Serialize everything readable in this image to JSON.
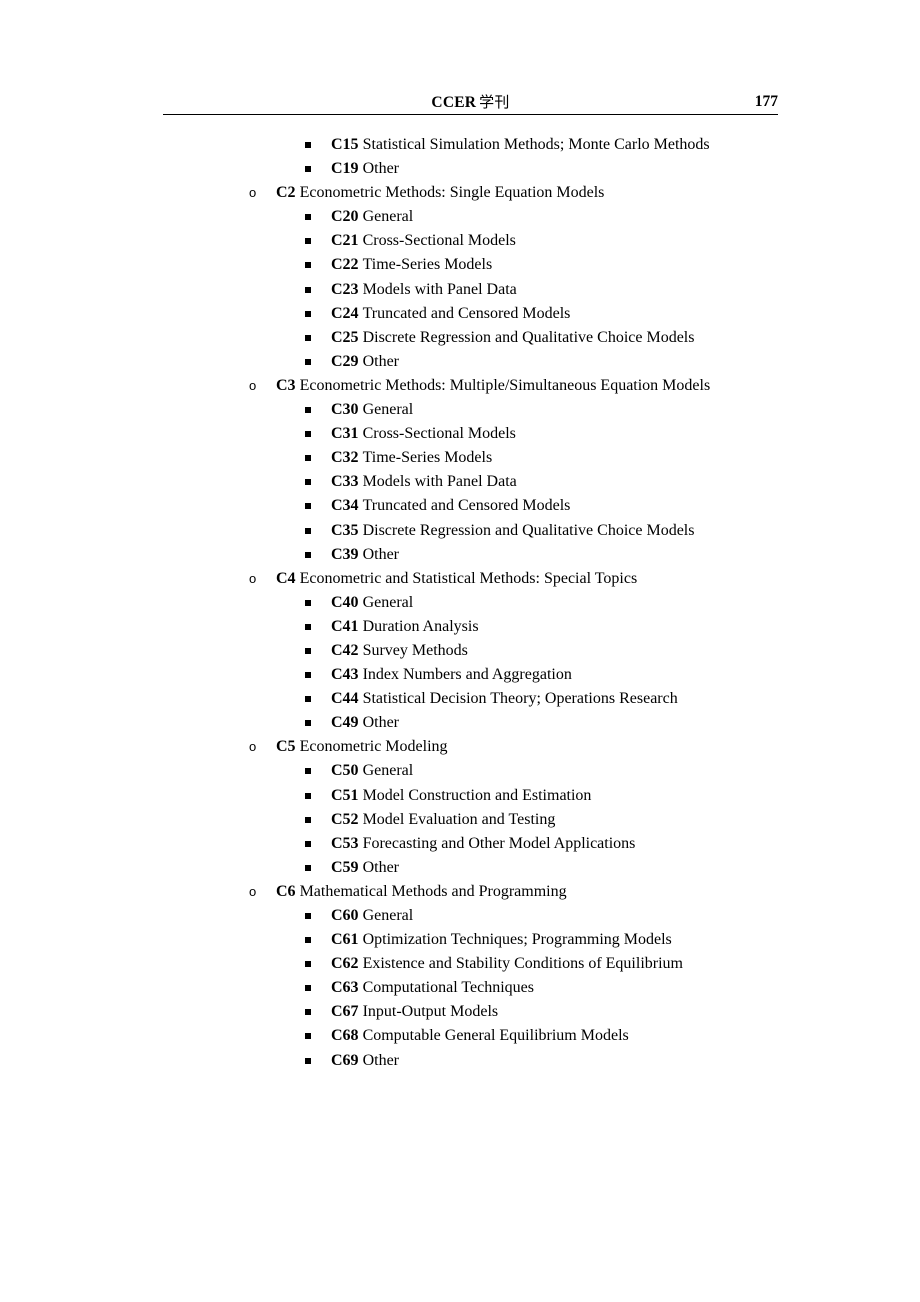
{
  "header": {
    "journal_latin": "CCER",
    "journal_cjk": "学刊",
    "page_number": "177"
  },
  "outline": {
    "rows": [
      {
        "level": 3,
        "bullet": "square-bullet",
        "code": "C15",
        "desc": "Statistical Simulation Methods; Monte Carlo Methods"
      },
      {
        "level": 3,
        "bullet": "square-bullet",
        "code": "C19",
        "desc": "Other"
      },
      {
        "level": 2,
        "bullet": "circle-bullet",
        "code": "C2",
        "desc": "Econometric Methods: Single Equation Models"
      },
      {
        "level": 3,
        "bullet": "square-bullet",
        "code": "C20",
        "desc": "General"
      },
      {
        "level": 3,
        "bullet": "square-bullet",
        "code": "C21",
        "desc": "Cross-Sectional Models"
      },
      {
        "level": 3,
        "bullet": "square-bullet",
        "code": "C22",
        "desc": "Time-Series Models"
      },
      {
        "level": 3,
        "bullet": "square-bullet",
        "code": "C23",
        "desc": "Models with Panel Data"
      },
      {
        "level": 3,
        "bullet": "square-bullet",
        "code": "C24",
        "desc": "Truncated and Censored Models"
      },
      {
        "level": 3,
        "bullet": "square-bullet",
        "code": "C25",
        "desc": "Discrete Regression and Qualitative Choice Models"
      },
      {
        "level": 3,
        "bullet": "square-bullet",
        "code": "C29",
        "desc": "Other"
      },
      {
        "level": 2,
        "bullet": "circle-bullet",
        "code": "C3",
        "desc": "Econometric Methods: Multiple/Simultaneous Equation Models"
      },
      {
        "level": 3,
        "bullet": "square-bullet",
        "code": "C30",
        "desc": "General"
      },
      {
        "level": 3,
        "bullet": "square-bullet",
        "code": "C31",
        "desc": "Cross-Sectional Models"
      },
      {
        "level": 3,
        "bullet": "square-bullet",
        "code": "C32",
        "desc": "Time-Series Models"
      },
      {
        "level": 3,
        "bullet": "square-bullet",
        "code": "C33",
        "desc": "Models with Panel Data"
      },
      {
        "level": 3,
        "bullet": "square-bullet",
        "code": "C34",
        "desc": "Truncated and Censored Models"
      },
      {
        "level": 3,
        "bullet": "square-bullet",
        "code": "C35",
        "desc": "Discrete Regression and Qualitative Choice Models"
      },
      {
        "level": 3,
        "bullet": "square-bullet",
        "code": "C39",
        "desc": "Other"
      },
      {
        "level": 2,
        "bullet": "circle-bullet",
        "code": "C4",
        "desc": "Econometric and Statistical Methods: Special Topics"
      },
      {
        "level": 3,
        "bullet": "square-bullet",
        "code": "C40",
        "desc": "General"
      },
      {
        "level": 3,
        "bullet": "square-bullet",
        "code": "C41",
        "desc": "Duration Analysis"
      },
      {
        "level": 3,
        "bullet": "square-bullet",
        "code": "C42",
        "desc": "Survey Methods"
      },
      {
        "level": 3,
        "bullet": "square-bullet",
        "code": "C43",
        "desc": "Index Numbers and Aggregation"
      },
      {
        "level": 3,
        "bullet": "square-bullet",
        "code": "C44",
        "desc": "Statistical Decision Theory; Operations Research"
      },
      {
        "level": 3,
        "bullet": "square-bullet",
        "code": "C49",
        "desc": "Other"
      },
      {
        "level": 2,
        "bullet": "circle-bullet",
        "code": "C5",
        "desc": "Econometric Modeling"
      },
      {
        "level": 3,
        "bullet": "square-bullet",
        "code": "C50",
        "desc": "General"
      },
      {
        "level": 3,
        "bullet": "square-bullet",
        "code": "C51",
        "desc": "Model Construction and Estimation"
      },
      {
        "level": 3,
        "bullet": "square-bullet",
        "code": "C52",
        "desc": "Model Evaluation and Testing"
      },
      {
        "level": 3,
        "bullet": "square-bullet",
        "code": "C53",
        "desc": "Forecasting and Other Model Applications"
      },
      {
        "level": 3,
        "bullet": "square-bullet",
        "code": "C59",
        "desc": "Other"
      },
      {
        "level": 2,
        "bullet": "circle-bullet",
        "code": "C6",
        "desc": "Mathematical Methods and Programming"
      },
      {
        "level": 3,
        "bullet": "square-bullet",
        "code": "C60",
        "desc": "General"
      },
      {
        "level": 3,
        "bullet": "square-bullet",
        "code": "C61",
        "desc": "Optimization Techniques; Programming Models"
      },
      {
        "level": 3,
        "bullet": "square-bullet",
        "code": "C62",
        "desc": "Existence and Stability Conditions of Equilibrium"
      },
      {
        "level": 3,
        "bullet": "square-bullet",
        "code": "C63",
        "desc": "Computational Techniques"
      },
      {
        "level": 3,
        "bullet": "square-bullet",
        "code": "C67",
        "desc": "Input-Output Models"
      },
      {
        "level": 3,
        "bullet": "square-bullet",
        "code": "C68",
        "desc": "Computable General Equilibrium Models"
      },
      {
        "level": 3,
        "bullet": "square-bullet",
        "code": "C69",
        "desc": "Other"
      }
    ],
    "circle_bullet_glyph": "o"
  }
}
